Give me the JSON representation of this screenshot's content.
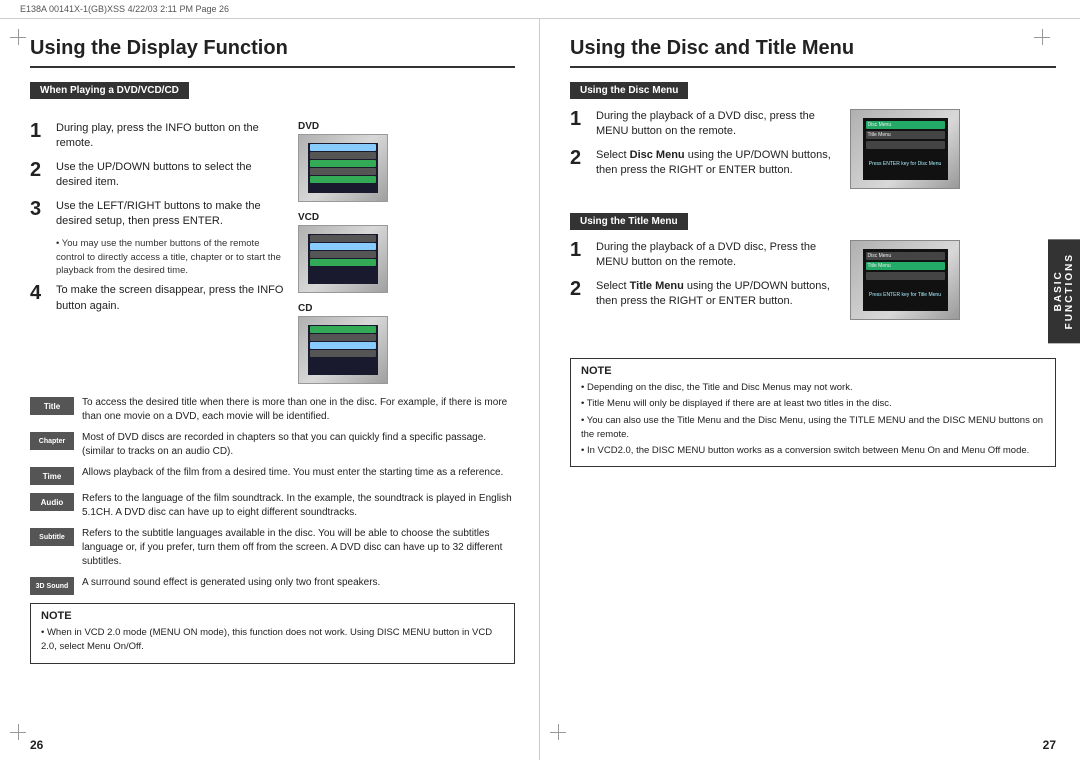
{
  "topbar": {
    "text": "E138A 00141X-1(GB)XSS  4/22/03  2:11 PM  Page 26"
  },
  "left": {
    "title": "Using the Display Function",
    "section_label": "When Playing a DVD/VCD/CD",
    "steps": [
      {
        "num": "1",
        "text": "During play, press the INFO button on the remote."
      },
      {
        "num": "2",
        "text": "Use the UP/DOWN buttons to select the desired item."
      },
      {
        "num": "3",
        "text": "Use the LEFT/RIGHT buttons to make the desired setup, then press ENTER."
      },
      {
        "num": "4",
        "text": "To make the screen disappear, press the INFO button again."
      }
    ],
    "sub_bullet": "You may use the number buttons of the remote control to directly access a title, chapter or to start the playback from the desired time.",
    "icons": [
      {
        "badge": "Title",
        "desc": "To access the desired title when there is more than one in the disc. For example, if there is more than one movie on a DVD, each movie will be identified."
      },
      {
        "badge": "Chapter",
        "desc": "Most of DVD discs are recorded in chapters so that you can quickly find a specific passage.  (similar to tracks on an audio CD)."
      },
      {
        "badge": "Time",
        "desc": "Allows playback of the film from a desired time. You must enter the starting time as a reference."
      },
      {
        "badge": "Audio",
        "desc": "Refers to the language of the film soundtrack. In the example, the soundtrack is played in English 5.1CH. A DVD disc can have up to eight different soundtracks."
      },
      {
        "badge": "Subtitle",
        "desc": "Refers to the subtitle languages available in the disc. You will be able to choose the subtitles language or, if you prefer, turn them off from the screen. A DVD disc can have up to 32 different subtitles."
      },
      {
        "badge": "3D Sound",
        "desc": "A surround sound effect is generated using only two front speakers."
      }
    ],
    "note_title": "NOTE",
    "note_lines": [
      "When in VCD 2.0 mode (MENU ON mode), this function does not work. Using DISC MENU button in VCD 2.0, select Menu On/Off."
    ],
    "device_labels": [
      "DVD",
      "VCD",
      "CD"
    ],
    "page_num": "26"
  },
  "right": {
    "title": "Using the Disc and Title Menu",
    "disc_menu": {
      "label": "Using the Disc Menu",
      "steps": [
        {
          "num": "1",
          "text": "During the playback of a DVD disc, press the MENU button on the remote."
        },
        {
          "num": "2",
          "text": "Select Disc Menu using the UP/DOWN buttons, then press the RIGHT or ENTER button.",
          "bold_word": "Disc Menu"
        }
      ]
    },
    "title_menu": {
      "label": "Using the Title Menu",
      "steps": [
        {
          "num": "1",
          "text": "During the playback of a DVD disc, Press the MENU button on the remote."
        },
        {
          "num": "2",
          "text": "Select Title Menu using the UP/DOWN buttons, then press the RIGHT or ENTER button.",
          "bold_word": "Title Menu"
        }
      ]
    },
    "note_title": "NOTE",
    "note_lines": [
      "Depending on the disc, the Title and Disc Menus may not work.",
      "Title Menu will only be displayed if there are at least two titles in the disc.",
      "You can also use the Title Menu and the Disc Menu, using the TITLE MENU and the DISC MENU buttons on the remote.",
      "In VCD2.0, the DISC MENU button works as a conversion switch between Menu On and Menu Off mode."
    ],
    "screen_labels": [
      "Press ENTER key for Disc Menu",
      "Press ENTER key for Title Menu"
    ],
    "page_num": "27"
  },
  "side_tab": {
    "line1": "BASIC",
    "line2": "FUNCTIONS"
  },
  "icons": {
    "crosshair": "+"
  }
}
